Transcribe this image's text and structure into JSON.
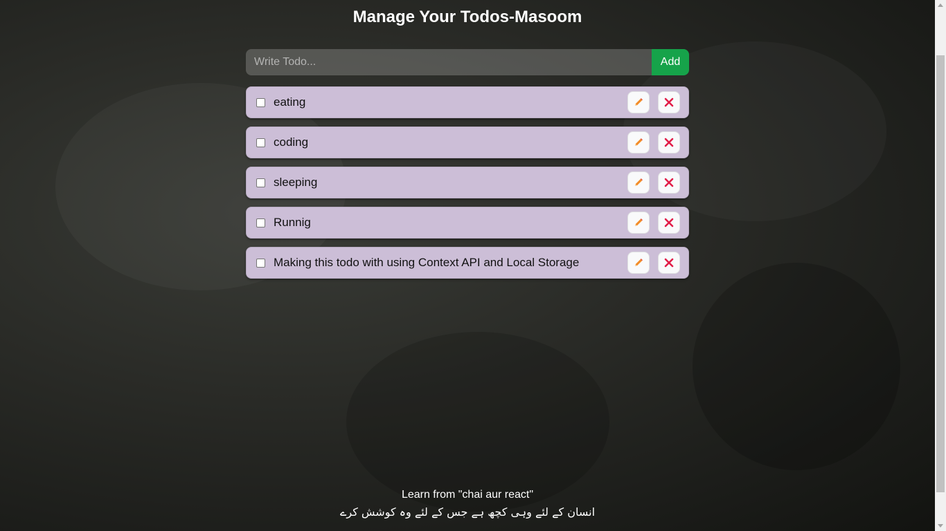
{
  "app": {
    "title": "Manage Your Todos-Masoom"
  },
  "add_form": {
    "placeholder": "Write Todo...",
    "value": "",
    "add_label": "Add",
    "add_color": "#16a34a"
  },
  "todos": [
    {
      "text": "eating",
      "completed": false
    },
    {
      "text": "coding",
      "completed": false
    },
    {
      "text": "sleeping",
      "completed": false
    },
    {
      "text": "Runnig",
      "completed": false
    },
    {
      "text": "Making this todo with using Context API and Local Storage",
      "completed": false
    }
  ],
  "todo_style": {
    "background": "#ccbed7",
    "edit_icon": "pencil-icon",
    "delete_icon": "close-icon",
    "delete_color": "#e11d48"
  },
  "footer": {
    "credit": "Learn from \"chai aur react\"",
    "quote": "انسان کے لئے وہی کچھ ہے جس کے لئے وہ کوشش کرے"
  }
}
